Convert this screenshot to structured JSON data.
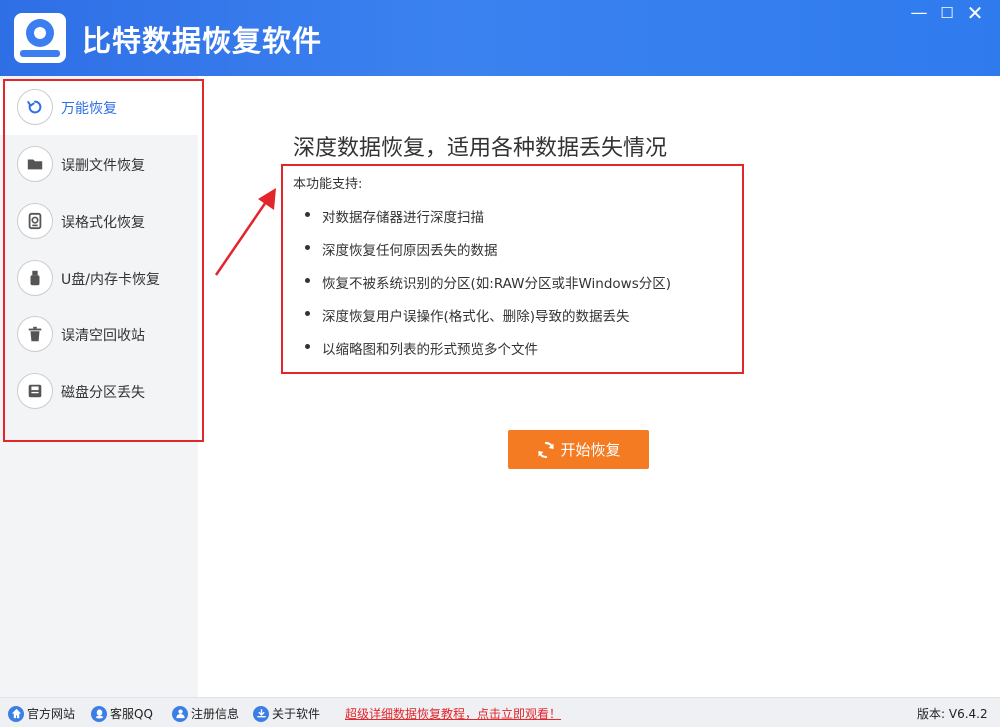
{
  "app": {
    "title": "比特数据恢复软件"
  },
  "window_controls": {
    "minimize": "—",
    "maximize": "☐",
    "close": "✕"
  },
  "sidebar": {
    "items": [
      {
        "label": "万能恢复",
        "icon": "refresh-icon",
        "active": true
      },
      {
        "label": "误删文件恢复",
        "icon": "folder-icon"
      },
      {
        "label": "误格式化恢复",
        "icon": "hard-disk-icon"
      },
      {
        "label": "U盘/内存卡恢复",
        "icon": "usb-drive-icon"
      },
      {
        "label": "误清空回收站",
        "icon": "trash-icon"
      },
      {
        "label": "磁盘分区丢失",
        "icon": "partition-icon"
      }
    ]
  },
  "main": {
    "title": "深度数据恢复，适用各种数据丢失情况",
    "features_heading": "本功能支持:",
    "features": [
      "对数据存储器进行深度扫描",
      "深度恢复任何原因丢失的数据",
      "恢复不被系统识别的分区(如:RAW分区或非Windows分区)",
      "深度恢复用户误操作(格式化、删除)导致的数据丢失",
      "以缩略图和列表的形式预览多个文件"
    ],
    "start_button": "开始恢复"
  },
  "statusbar": {
    "website": "官方网站",
    "support_qq": "客服QQ",
    "register": "注册信息",
    "about": "关于软件",
    "tutorial_link": "超级详细数据恢复教程，点击立即观看！",
    "version": "版本: V6.4.2"
  },
  "colors": {
    "brand_blue": "#2f6fe6",
    "accent_orange": "#f47b22",
    "highlight_red": "#e2262b"
  }
}
